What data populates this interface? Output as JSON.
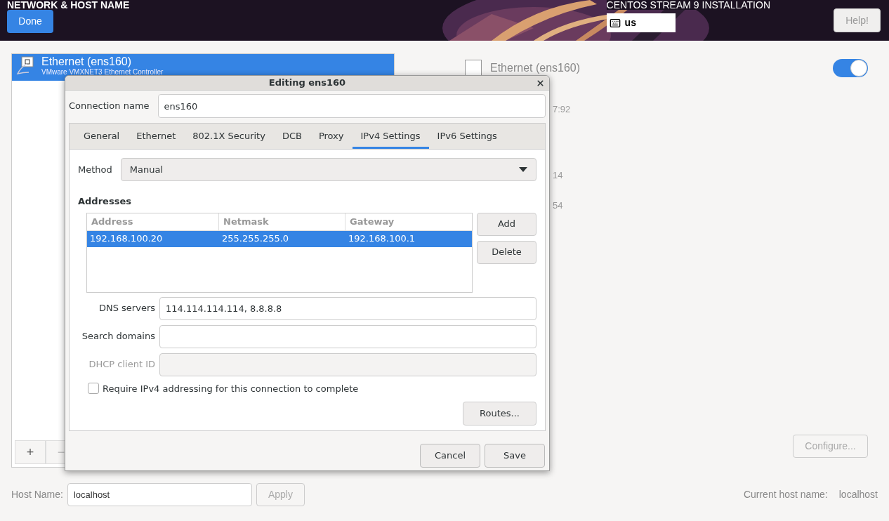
{
  "header": {
    "title": "NETWORK & HOST NAME",
    "done_button": "Done",
    "product": "CENTOS STREAM 9 INSTALLATION",
    "keyboard_layout": "us",
    "help_button": "Help!"
  },
  "devices": [
    {
      "name": "Ethernet (ens160)",
      "description": "VMware VMXNET3 Ethernet Controller",
      "selected": true
    }
  ],
  "device_buttons": [
    {
      "label": "+",
      "disabled": false
    },
    {
      "label": "−",
      "disabled": true
    }
  ],
  "detail": {
    "name": "Ethernet (ens160)",
    "on": true,
    "fragments": [
      "7:92",
      "14",
      "54"
    ],
    "configure_button": "Configure..."
  },
  "hostname": {
    "label": "Host Name:",
    "value": "localhost",
    "apply_button": "Apply",
    "current_label": "Current host name:",
    "current_value": "localhost"
  },
  "dialog": {
    "title": "Editing ens160",
    "connection_label": "Connection name",
    "connection_name": "ens160",
    "tabs": [
      {
        "label": "General",
        "selected": false
      },
      {
        "label": "Ethernet",
        "selected": false
      },
      {
        "label": "802.1X Security",
        "selected": false
      },
      {
        "label": "DCB",
        "selected": false
      },
      {
        "label": "Proxy",
        "selected": false
      },
      {
        "label": "IPv4 Settings",
        "selected": true
      },
      {
        "label": "IPv6 Settings",
        "selected": false
      }
    ],
    "method_label": "Method",
    "method": "Manual",
    "addresses_heading": "Addresses",
    "columns": [
      "Address",
      "Netmask",
      "Gateway"
    ],
    "rows": [
      {
        "cells": [
          "192.168.100.20",
          "255.255.255.0",
          "192.168.100.1"
        ],
        "selected": true
      }
    ],
    "add_button": "Add",
    "delete_button": "Delete",
    "fields": [
      {
        "label": "DNS servers",
        "value": "114.114.114.114, 8.8.8.8",
        "disabled": false
      },
      {
        "label": "Search domains",
        "disabled": false
      },
      {
        "label": "DHCP client ID",
        "disabled": true
      }
    ],
    "checkbox": {
      "label": "Require IPv4 addressing for this connection to complete",
      "checked": false
    },
    "routes_button": "Routes...",
    "cancel_button": "Cancel",
    "save_button": "Save"
  }
}
